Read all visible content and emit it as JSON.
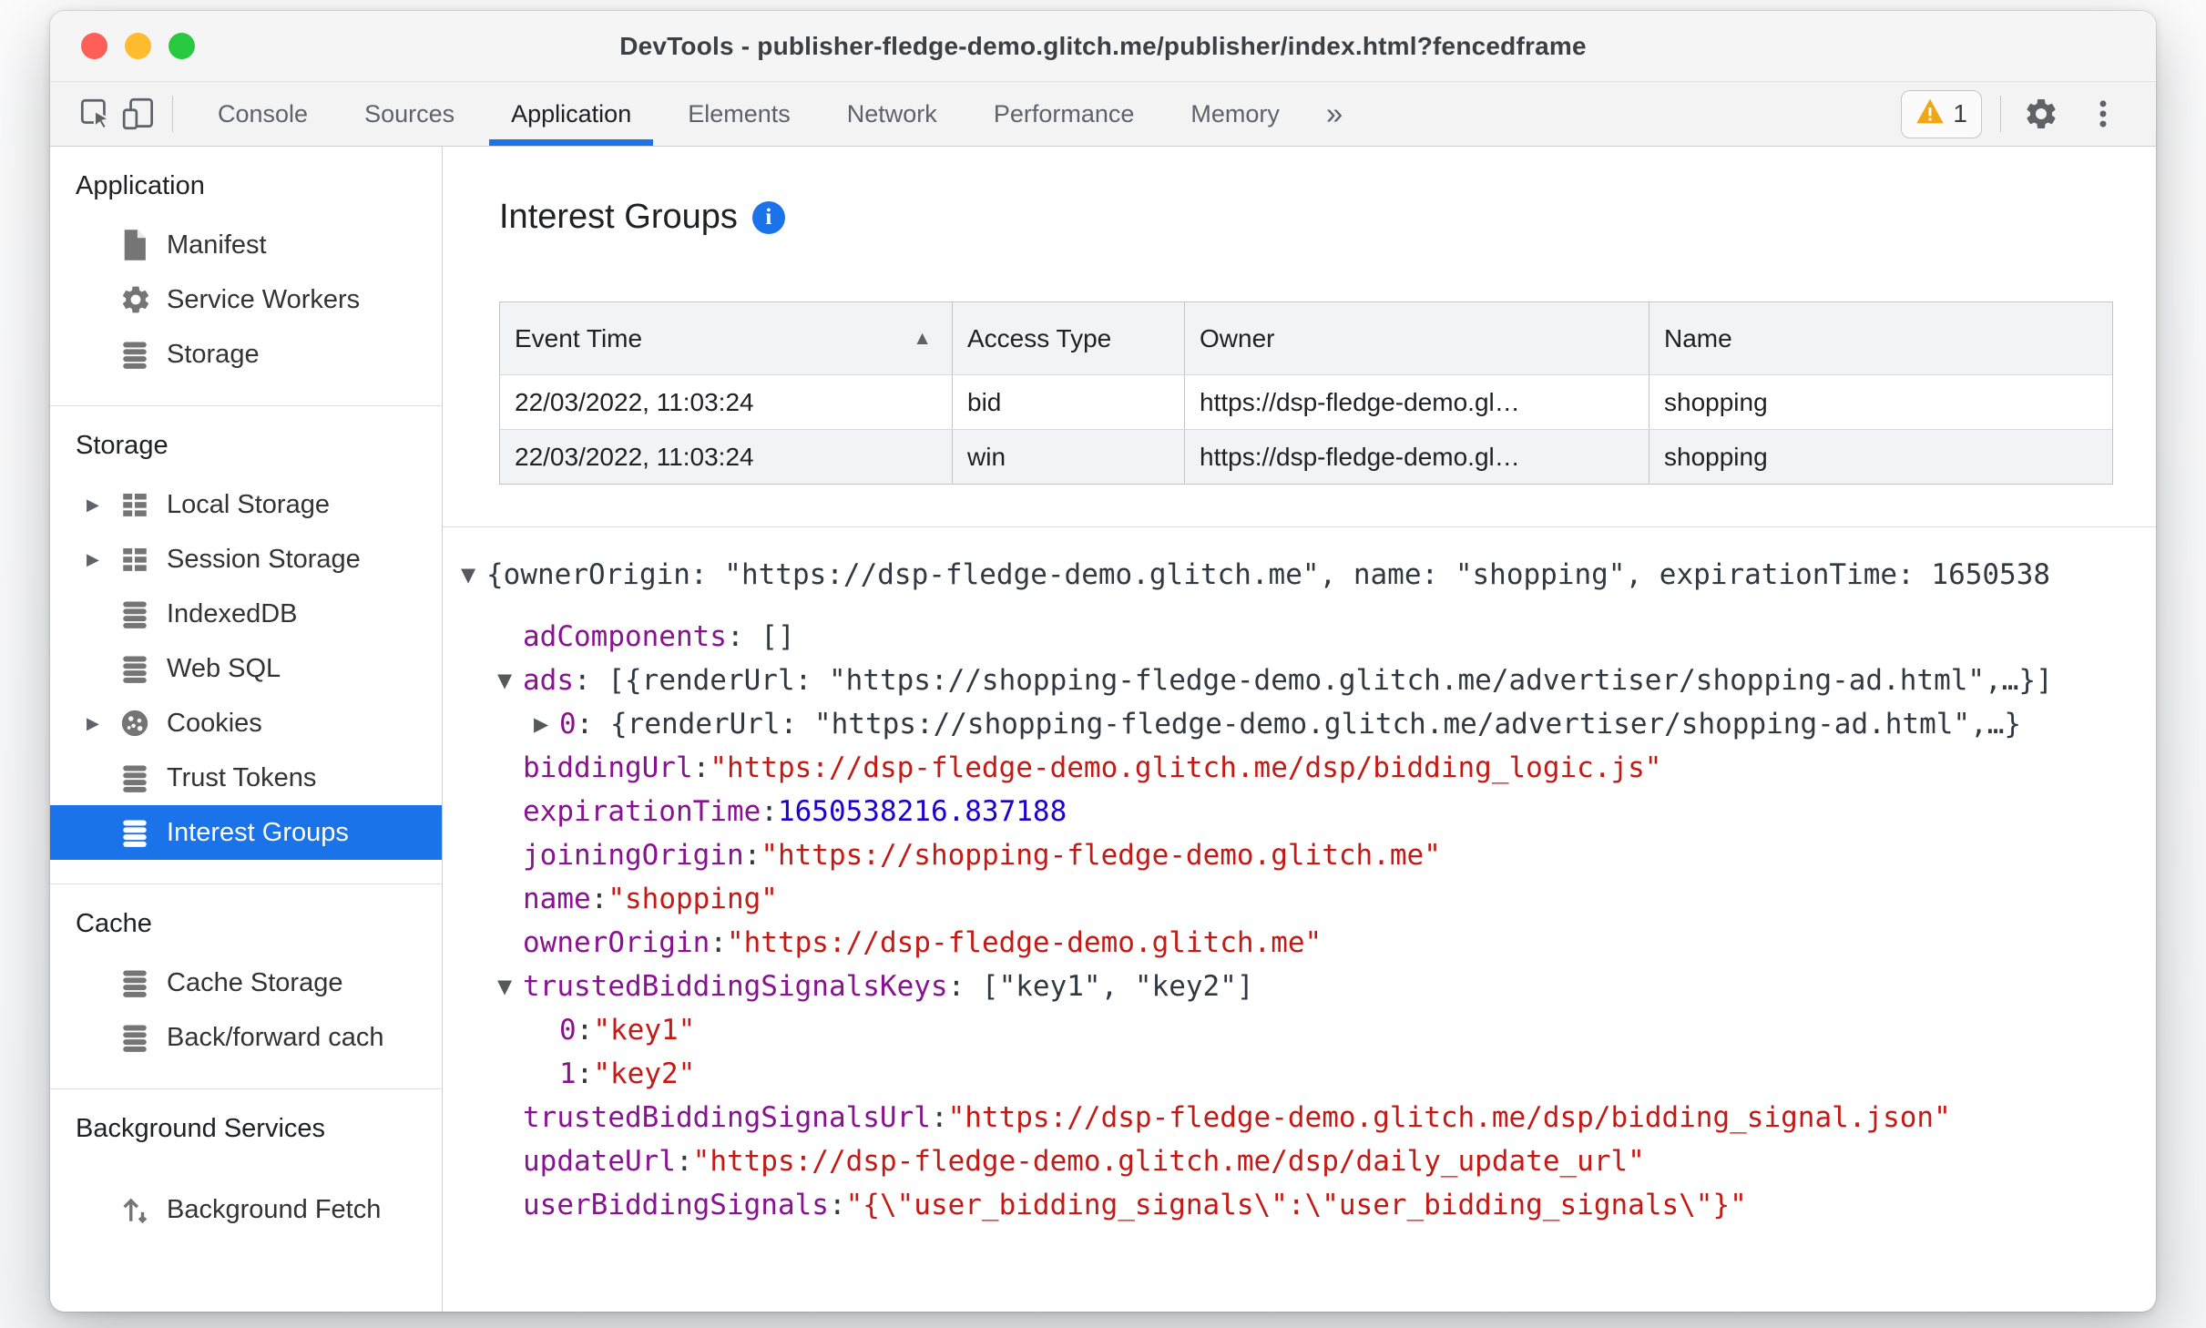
{
  "window": {
    "title": "DevTools - publisher-fledge-demo.glitch.me/publisher/index.html?fencedframe",
    "traffic_lights": [
      "#ff5f57",
      "#febc2e",
      "#28c840"
    ]
  },
  "toolbar": {
    "left_icons": [
      "inspect-icon",
      "device-toolbar-icon"
    ],
    "tabs": [
      {
        "label": "Console",
        "selected": false
      },
      {
        "label": "Sources",
        "selected": false
      },
      {
        "label": "Application",
        "selected": true
      },
      {
        "label": "Elements",
        "selected": false
      },
      {
        "label": "Network",
        "selected": false
      },
      {
        "label": "Performance",
        "selected": false
      },
      {
        "label": "Memory",
        "selected": false
      }
    ],
    "more_tabs_glyph": "»",
    "warning_badge": {
      "count": "1",
      "icon": "warning-icon"
    },
    "right_icons": [
      "settings-gear-icon",
      "more-options-icon"
    ]
  },
  "sidebar": {
    "sections": [
      {
        "header": "Application",
        "items": [
          {
            "label": "Manifest",
            "icon": "manifest-file-icon"
          },
          {
            "label": "Service Workers",
            "icon": "service-worker-gear-icon"
          },
          {
            "label": "Storage",
            "icon": "database-icon"
          }
        ]
      },
      {
        "header": "Storage",
        "items": [
          {
            "label": "Local Storage",
            "icon": "table-icon",
            "expandable": true
          },
          {
            "label": "Session Storage",
            "icon": "table-icon",
            "expandable": true
          },
          {
            "label": "IndexedDB",
            "icon": "database-icon"
          },
          {
            "label": "Web SQL",
            "icon": "database-icon"
          },
          {
            "label": "Cookies",
            "icon": "cookie-icon",
            "expandable": true
          },
          {
            "label": "Trust Tokens",
            "icon": "database-icon"
          },
          {
            "label": "Interest Groups",
            "icon": "database-icon",
            "selected": true
          }
        ]
      },
      {
        "header": "Cache",
        "items": [
          {
            "label": "Cache Storage",
            "icon": "database-icon"
          },
          {
            "label": "Back/forward cach",
            "icon": "database-icon"
          }
        ]
      },
      {
        "header": "Background Services",
        "items": [
          {
            "label": "Background Fetch",
            "icon": "background-fetch-icon"
          }
        ]
      }
    ]
  },
  "main": {
    "title": "Interest Groups",
    "info_icon": "info-icon",
    "events_table": {
      "columns": [
        {
          "label": "Event Time",
          "sort": "asc"
        },
        {
          "label": "Access Type",
          "sort": ""
        },
        {
          "label": "Owner",
          "sort": ""
        },
        {
          "label": "Name",
          "sort": ""
        }
      ],
      "rows": [
        {
          "event_time": "22/03/2022, 11:03:24",
          "access_type": "bid",
          "owner": "https://dsp-fledge-demo.gl…",
          "name": "shopping"
        },
        {
          "event_time": "22/03/2022, 11:03:24",
          "access_type": "win",
          "owner": "https://dsp-fledge-demo.gl…",
          "name": "shopping"
        }
      ]
    },
    "details_tree": {
      "lines": [
        {
          "indent": 0,
          "arrow": "down",
          "segs": [
            {
              "c": "plain",
              "t": "{ownerOrigin: \"https://dsp-fledge-demo.glitch.me\", name: \"shopping\", expirationTime: 1650538"
            }
          ]
        },
        {
          "indent": 1,
          "arrow": "",
          "segs": [
            {
              "c": "key",
              "t": "adComponents"
            },
            {
              "c": "plain",
              "t": ": []"
            }
          ]
        },
        {
          "indent": 1,
          "arrow": "down",
          "segs": [
            {
              "c": "key",
              "t": "ads"
            },
            {
              "c": "plain",
              "t": ": [{renderUrl: \"https://shopping-fledge-demo.glitch.me/advertiser/shopping-ad.html\",…}]"
            }
          ]
        },
        {
          "indent": 2,
          "arrow": "right",
          "segs": [
            {
              "c": "key",
              "t": "0"
            },
            {
              "c": "plain",
              "t": ": {renderUrl: \"https://shopping-fledge-demo.glitch.me/advertiser/shopping-ad.html\",…}"
            }
          ]
        },
        {
          "indent": 1,
          "arrow": "",
          "segs": [
            {
              "c": "key",
              "t": "biddingUrl"
            },
            {
              "c": "plain",
              "t": ": "
            },
            {
              "c": "str",
              "t": "\"https://dsp-fledge-demo.glitch.me/dsp/bidding_logic.js\""
            }
          ]
        },
        {
          "indent": 1,
          "arrow": "",
          "segs": [
            {
              "c": "key",
              "t": "expirationTime"
            },
            {
              "c": "plain",
              "t": ": "
            },
            {
              "c": "num",
              "t": "1650538216.837188"
            }
          ]
        },
        {
          "indent": 1,
          "arrow": "",
          "segs": [
            {
              "c": "key",
              "t": "joiningOrigin"
            },
            {
              "c": "plain",
              "t": ": "
            },
            {
              "c": "str",
              "t": "\"https://shopping-fledge-demo.glitch.me\""
            }
          ]
        },
        {
          "indent": 1,
          "arrow": "",
          "segs": [
            {
              "c": "key",
              "t": "name"
            },
            {
              "c": "plain",
              "t": ": "
            },
            {
              "c": "str",
              "t": "\"shopping\""
            }
          ]
        },
        {
          "indent": 1,
          "arrow": "",
          "segs": [
            {
              "c": "key",
              "t": "ownerOrigin"
            },
            {
              "c": "plain",
              "t": ": "
            },
            {
              "c": "str",
              "t": "\"https://dsp-fledge-demo.glitch.me\""
            }
          ]
        },
        {
          "indent": 1,
          "arrow": "down",
          "segs": [
            {
              "c": "key",
              "t": "trustedBiddingSignalsKeys"
            },
            {
              "c": "plain",
              "t": ": [\"key1\", \"key2\"]"
            }
          ]
        },
        {
          "indent": 2,
          "arrow": "",
          "segs": [
            {
              "c": "key",
              "t": "0"
            },
            {
              "c": "plain",
              "t": ": "
            },
            {
              "c": "str",
              "t": "\"key1\""
            }
          ]
        },
        {
          "indent": 2,
          "arrow": "",
          "segs": [
            {
              "c": "key",
              "t": "1"
            },
            {
              "c": "plain",
              "t": ": "
            },
            {
              "c": "str",
              "t": "\"key2\""
            }
          ]
        },
        {
          "indent": 1,
          "arrow": "",
          "segs": [
            {
              "c": "key",
              "t": "trustedBiddingSignalsUrl"
            },
            {
              "c": "plain",
              "t": ": "
            },
            {
              "c": "str",
              "t": "\"https://dsp-fledge-demo.glitch.me/dsp/bidding_signal.json\""
            }
          ]
        },
        {
          "indent": 1,
          "arrow": "",
          "segs": [
            {
              "c": "key",
              "t": "updateUrl"
            },
            {
              "c": "plain",
              "t": ": "
            },
            {
              "c": "str",
              "t": "\"https://dsp-fledge-demo.glitch.me/dsp/daily_update_url\""
            }
          ]
        },
        {
          "indent": 1,
          "arrow": "",
          "segs": [
            {
              "c": "key",
              "t": "userBiddingSignals"
            },
            {
              "c": "plain",
              "t": ": "
            },
            {
              "c": "str",
              "t": "\"{\\\"user_bidding_signals\\\":\\\"user_bidding_signals\\\"}\""
            }
          ]
        }
      ]
    }
  },
  "colors": {
    "accent_blue": "#1a73e8",
    "selected_row_bg": "#1a73e8",
    "warning_orange": "#efa713",
    "syntax_key": "#881391",
    "syntax_string": "#c41a16",
    "syntax_number": "#1c00cf",
    "tree_plain_text": "#303942"
  }
}
